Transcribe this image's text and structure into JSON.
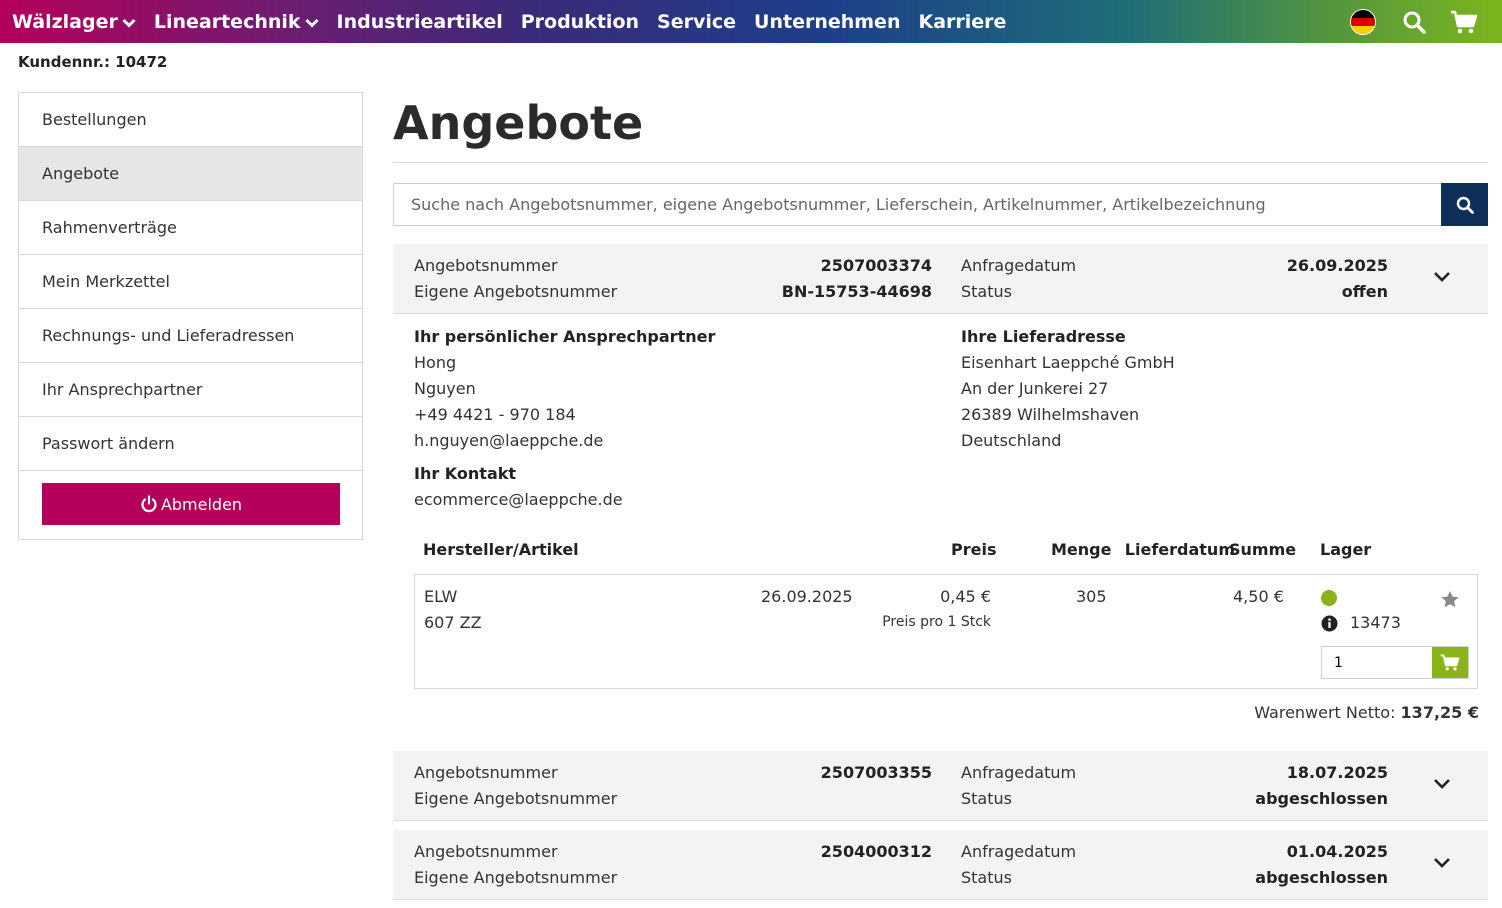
{
  "nav": {
    "items": [
      {
        "label": "Wälzlager",
        "has_dropdown": true
      },
      {
        "label": "Lineartechnik",
        "has_dropdown": true
      },
      {
        "label": "Industrieartikel",
        "has_dropdown": false
      },
      {
        "label": "Produktion",
        "has_dropdown": false
      },
      {
        "label": "Service",
        "has_dropdown": false
      },
      {
        "label": "Unternehmen",
        "has_dropdown": false
      },
      {
        "label": "Karriere",
        "has_dropdown": false
      }
    ],
    "icons": [
      "germany-flag-icon",
      "search-icon",
      "cart-icon"
    ]
  },
  "account": {
    "kundennr": "Kundennr.: 10472"
  },
  "sidebar": {
    "items": [
      {
        "label": "Bestellungen",
        "active": false
      },
      {
        "label": "Angebote",
        "active": true
      },
      {
        "label": "Rahmenverträge",
        "active": false
      },
      {
        "label": "Mein Merkzettel",
        "active": false
      },
      {
        "label": "Rechnungs- und Lieferadressen",
        "active": false
      },
      {
        "label": "Ihr Ansprechpartner",
        "active": false
      },
      {
        "label": "Passwort ändern",
        "active": false
      }
    ],
    "logout_label": "Abmelden"
  },
  "main": {
    "title": "Angebote",
    "search_placeholder": "Suche nach Angebotsnummer, eigene Angebotsnummer, Lieferschein, Artikelnummer, Artikelbezeichnung"
  },
  "labels": {
    "angebotsnummer": "Angebotsnummer",
    "eigene": "Eigene Angebotsnummer",
    "anfragedatum": "Anfragedatum",
    "status": "Status"
  },
  "offers": [
    {
      "nummer": "2507003374",
      "eigene": "BN-15753-44698",
      "datum": "26.09.2025",
      "status": "offen",
      "accent": "#b5005b",
      "expanded": true
    },
    {
      "nummer": "2507003355",
      "eigene": "",
      "datum": "18.07.2025",
      "status": "abgeschlossen",
      "accent": "#8ab31a",
      "expanded": false
    },
    {
      "nummer": "2504000312",
      "eigene": "",
      "datum": "01.04.2025",
      "status": "abgeschlossen",
      "accent": "#8ab31a",
      "expanded": false
    }
  ],
  "detail": {
    "contact_heading": "Ihr persönlicher Ansprechpartner",
    "contact_first": "Hong",
    "contact_last": "Nguyen",
    "contact_phone": "+49 4421 - 970 184",
    "contact_email": "h.nguyen@laeppche.de",
    "kontakt_heading": "Ihr Kontakt",
    "kontakt_email": "ecommerce@laeppche.de",
    "address_heading": "Ihre Lieferadresse",
    "address_company": "Eisenhart Laeppché GmbH",
    "address_street": "An der Junkerei 27",
    "address_city": "26389 Wilhelmshaven",
    "address_country": "Deutschland",
    "table_headers": {
      "artikel": "Hersteller/Artikel",
      "lieferdatum": "Lieferdatum",
      "preis": "Preis",
      "menge": "Menge",
      "summe": "Summe",
      "lager": "Lager"
    },
    "row": {
      "hersteller": "ELW",
      "artikel": "607 ZZ",
      "lieferdatum": "26.09.2025",
      "preis": "0,45 €",
      "preis_einheit": "Preis pro 1 Stck",
      "menge": "305",
      "summe": "4,50 €",
      "lager_menge": "13473",
      "qty_value": "1"
    },
    "netto_label": "Warenwert Netto:",
    "netto_value": "137,25 €"
  },
  "colors": {
    "brand": "#b5005b",
    "navy": "#0e2f5a",
    "green": "#8ab31a"
  }
}
